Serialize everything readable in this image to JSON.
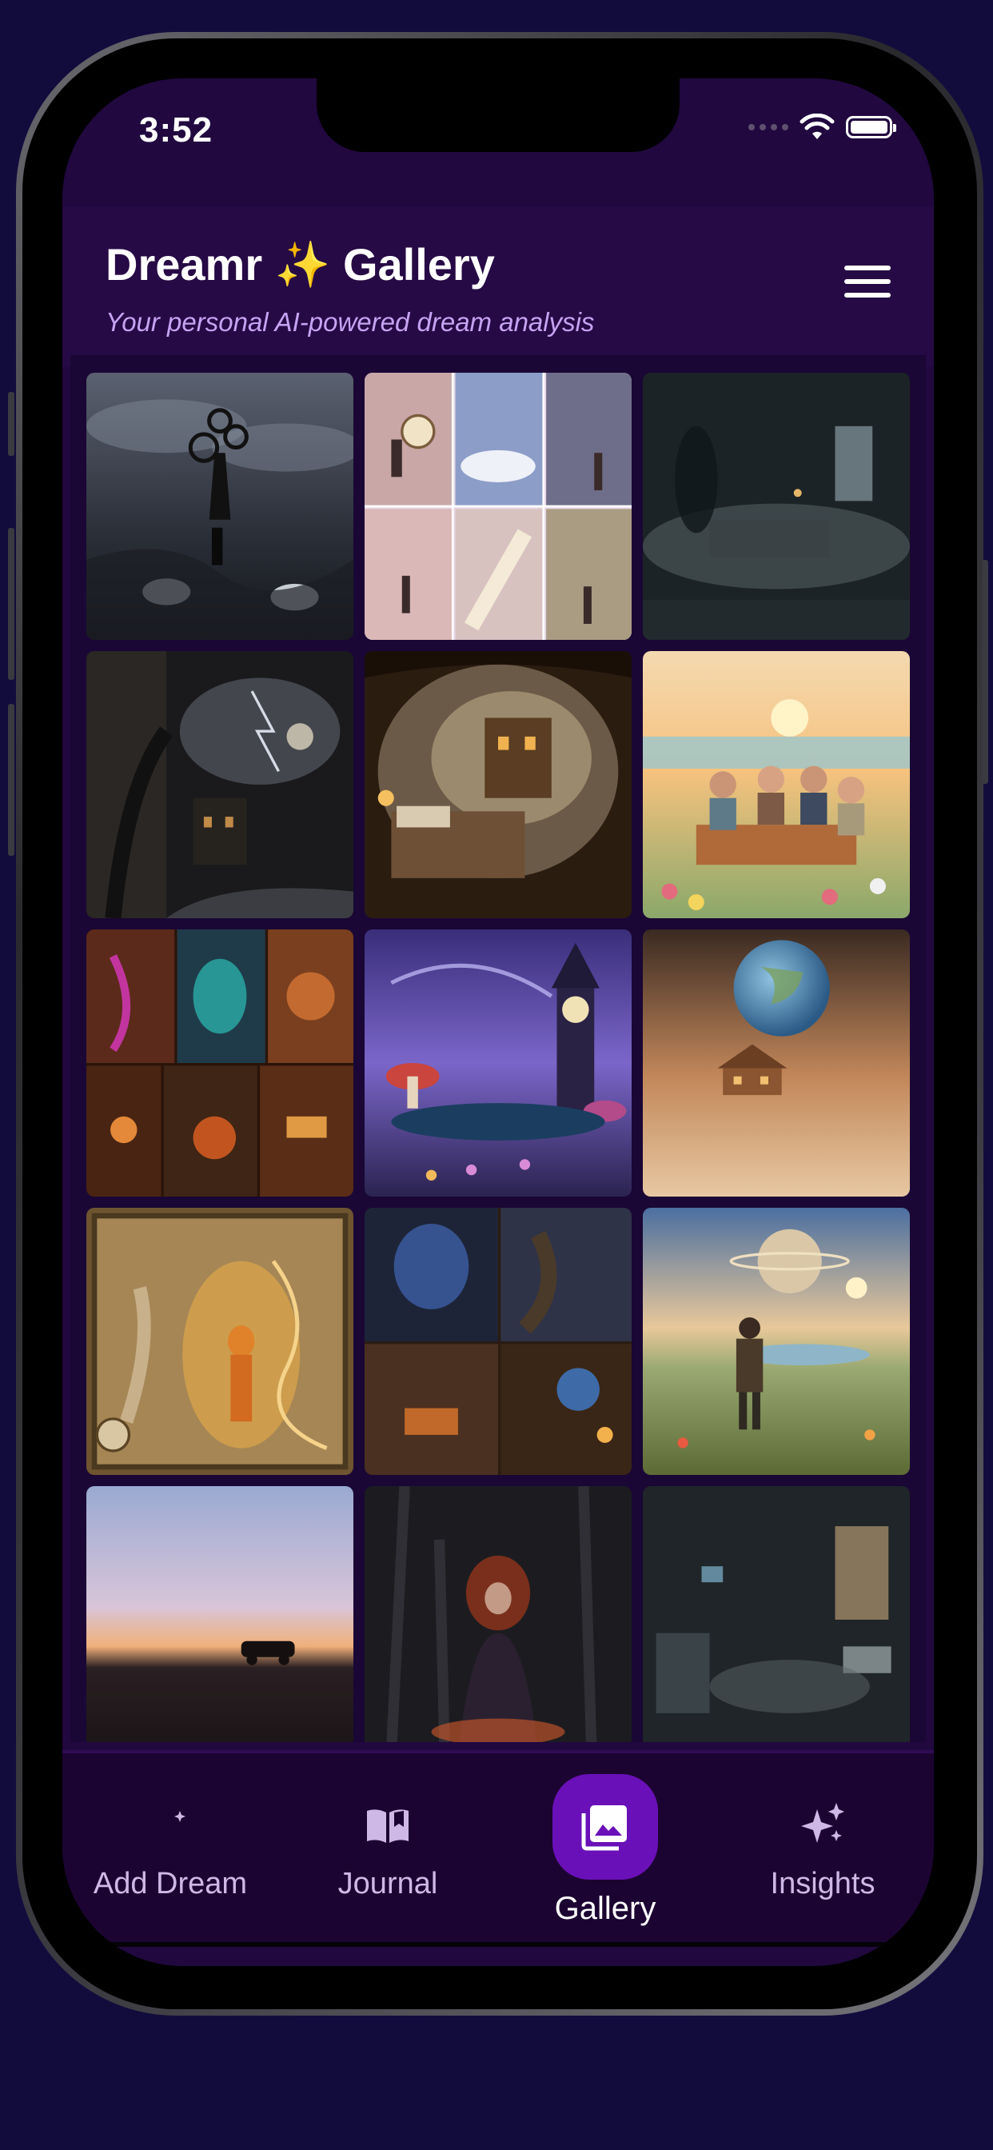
{
  "status_bar": {
    "time": "3:52"
  },
  "header": {
    "title": "Dreamr ✨ Gallery",
    "subtitle": "Your personal AI-powered dream analysis",
    "menu_icon": "hamburger-menu-icon"
  },
  "gallery": {
    "tiles": [
      {
        "scene": "stormy-clock-tree-figure"
      },
      {
        "scene": "collage-clock-stairs-clouds"
      },
      {
        "scene": "foggy-dark-bedroom"
      },
      {
        "scene": "dark-stone-village-clock-storm"
      },
      {
        "scene": "cave-bedroom-lanterns"
      },
      {
        "scene": "friends-puzzle-sunset-flowers"
      },
      {
        "scene": "collage-glowing-underground-rooms"
      },
      {
        "scene": "night-clocktower-mushroom-lake"
      },
      {
        "scene": "earth-over-desert-house"
      },
      {
        "scene": "golden-glowing-figure-relief"
      },
      {
        "scene": "collage-portal-cabin-rooms"
      },
      {
        "scene": "traveler-planet-meadow"
      },
      {
        "scene": "sunset-car-horizon"
      },
      {
        "scene": "dark-forest-redhead-figure"
      },
      {
        "scene": "abandoned-foggy-room"
      }
    ]
  },
  "nav": {
    "items": [
      {
        "label": "Add Dream",
        "icon": "moon-sparkle-icon"
      },
      {
        "label": "Journal",
        "icon": "open-book-icon"
      },
      {
        "label": "Gallery",
        "icon": "photo-library-icon",
        "active": true
      },
      {
        "label": "Insights",
        "icon": "sparkles-icon"
      }
    ],
    "active_color": "#6a10b8"
  },
  "colors": {
    "background": "#120c3d",
    "screen": "#21083f",
    "subtitle": "#c6a3f2"
  }
}
